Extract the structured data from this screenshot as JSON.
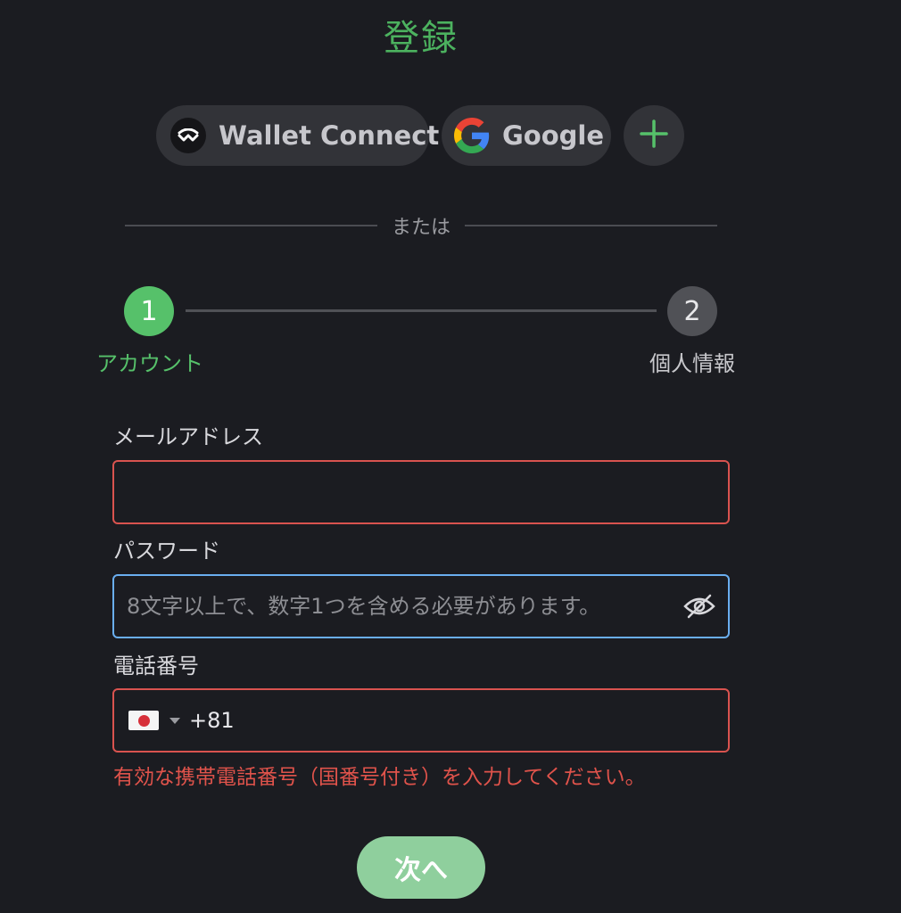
{
  "title": "登録",
  "social": {
    "wallet_label": "Wallet Connect",
    "google_label": "Google",
    "more_label": "+"
  },
  "divider_text": "または",
  "steps": [
    {
      "number": "1",
      "label": "アカウント",
      "state": "active"
    },
    {
      "number": "2",
      "label": "個人情報",
      "state": "inactive"
    }
  ],
  "form": {
    "email": {
      "label": "メールアドレス",
      "value": "",
      "placeholder": ""
    },
    "password": {
      "label": "パスワード",
      "value": "",
      "placeholder": "8文字以上で、数字1つを含める必要があります。"
    },
    "phone": {
      "label": "電話番号",
      "country": "JP",
      "dial_code": "+81",
      "value": ""
    },
    "phone_error": "有効な携帯電話番号（国番号付き）を入力してください。"
  },
  "next_label": "次へ",
  "colors": {
    "background": "#1b1c21",
    "accent": "#56c16a",
    "error": "#d9534f",
    "focus": "#6aaef0",
    "button_disabled": "#8fcf9d"
  },
  "icons": {
    "wallet": "walletconnect-icon",
    "google": "google-icon",
    "plus": "plus-icon",
    "eye": "eye-slash-icon",
    "flag": "japan-flag-icon",
    "caret": "caret-down-icon"
  }
}
